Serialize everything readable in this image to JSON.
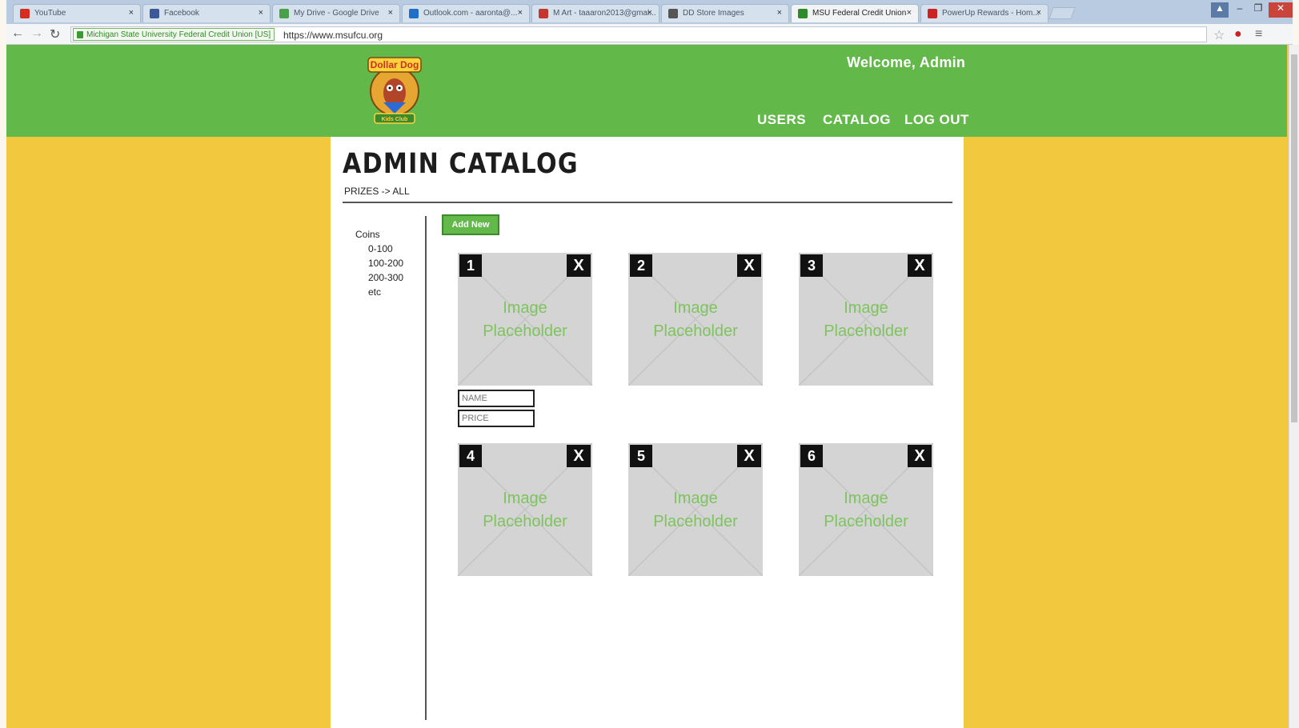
{
  "browser": {
    "tabs": [
      {
        "label": "YouTube",
        "color": "#d62d20"
      },
      {
        "label": "Facebook",
        "color": "#3b5998"
      },
      {
        "label": "My Drive - Google Drive",
        "color": "#4aa04a"
      },
      {
        "label": "Outlook.com - aaronta@...",
        "color": "#1e6fc7"
      },
      {
        "label": "M Art - taaaron2013@gmai...",
        "color": "#c5362e"
      },
      {
        "label": "DD Store Images",
        "color": "#555555"
      },
      {
        "label": "MSU Federal Credit Union",
        "color": "#2f8a2a"
      },
      {
        "label": "PowerUp Rewards - Hom...",
        "color": "#cc2222"
      }
    ],
    "ev_label": "Michigan State University Federal Credit Union [US]",
    "url": "https://www.msufcu.org"
  },
  "header": {
    "welcome": "Welcome, Admin",
    "nav": [
      "USERS",
      "CATALOG",
      "LOG OUT"
    ],
    "logo_text_top": "Dollar Dog",
    "logo_text_bottom": "Kids Club"
  },
  "page": {
    "title": "ADMIN CATALOG",
    "breadcrumb": "PRIZES -> ALL",
    "add_new": "Add New"
  },
  "filters": {
    "heading": "Coins",
    "items": [
      "0-100",
      "100-200",
      "200-300",
      "etc"
    ]
  },
  "cards": [
    {
      "number": "1",
      "close": "X",
      "line1": "Image",
      "line2": "Placeholder"
    },
    {
      "number": "2",
      "close": "X",
      "line1": "Image",
      "line2": "Placeholder"
    },
    {
      "number": "3",
      "close": "X",
      "line1": "Image",
      "line2": "Placeholder"
    },
    {
      "number": "4",
      "close": "X",
      "line1": "Image",
      "line2": "Placeholder"
    },
    {
      "number": "5",
      "close": "X",
      "line1": "Image",
      "line2": "Placeholder"
    },
    {
      "number": "6",
      "close": "X",
      "line1": "Image",
      "line2": "Placeholder"
    }
  ],
  "fields": {
    "name_placeholder": "NAME",
    "price_placeholder": "PRICE"
  },
  "colors": {
    "header_green": "#62b94a",
    "background_yellow": "#f2c83f",
    "placeholder_text": "#7ec45e"
  }
}
